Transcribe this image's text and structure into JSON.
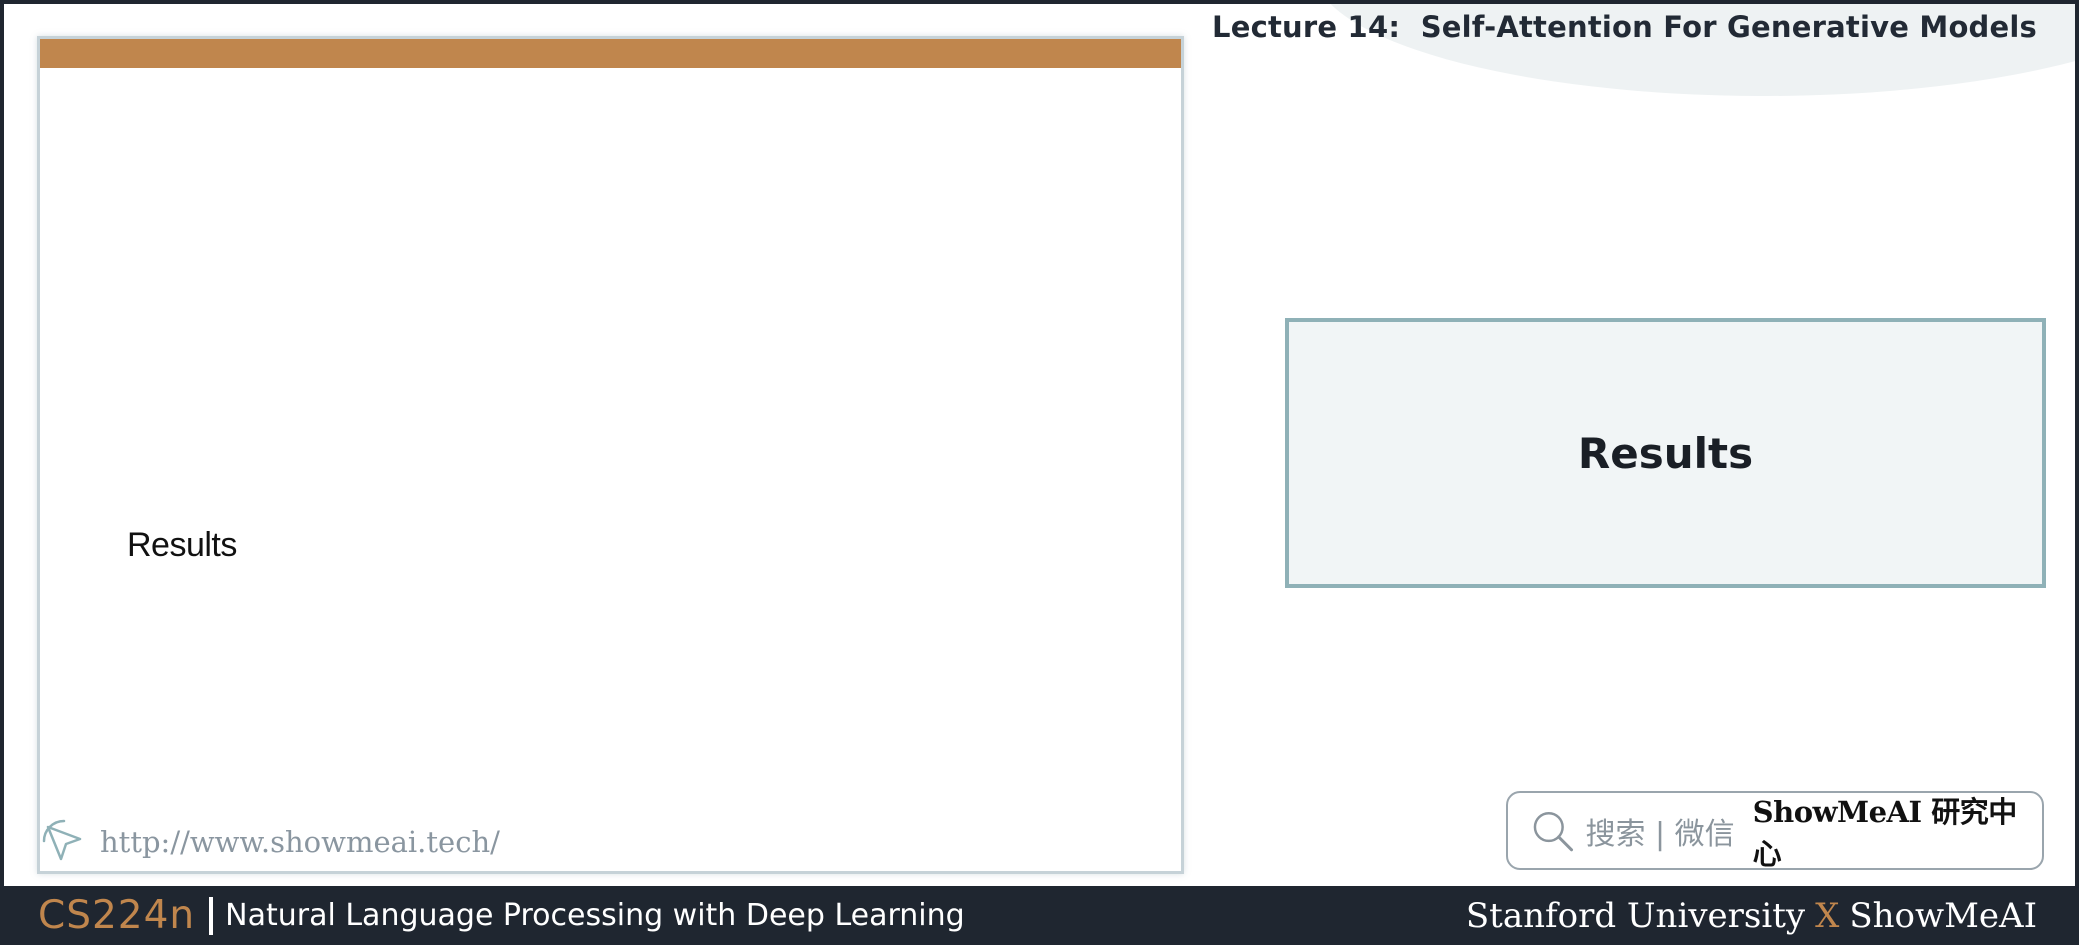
{
  "header": {
    "lecture_title": "Lecture 14:  Self-Attention For Generative Models"
  },
  "slide": {
    "heading": "Results",
    "url": "http://www.showmeai.tech/"
  },
  "side_panel": {
    "results_label": "Results"
  },
  "search_badge": {
    "hint": "搜索 | 微信",
    "brand": "ShowMeAI 研究中心"
  },
  "footer": {
    "course_code": "CS224n",
    "course_name": "Natural Language Processing with Deep Learning",
    "org_left": "Stanford University",
    "org_x": "X",
    "org_right": "ShowMeAI"
  },
  "colors": {
    "accent": "#c0864d",
    "footer_bg": "#1f2630",
    "panel_border": "#8fb1b7",
    "panel_bg": "#f1f5f6"
  }
}
